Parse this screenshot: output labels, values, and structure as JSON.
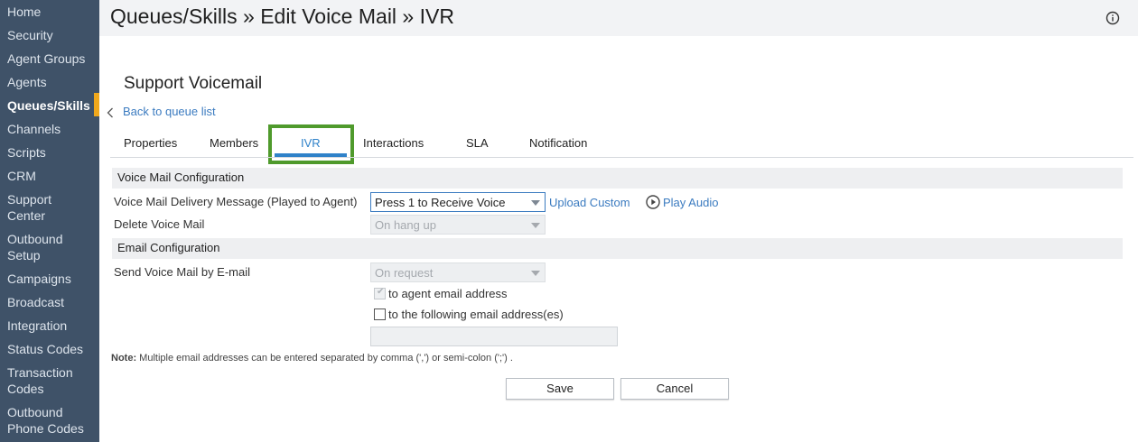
{
  "sidebar": {
    "items": [
      {
        "label": "Home"
      },
      {
        "label": "Security"
      },
      {
        "label": "Agent Groups"
      },
      {
        "label": "Agents"
      },
      {
        "label": "Queues/Skills",
        "active": true
      },
      {
        "label": "Channels"
      },
      {
        "label": "Scripts"
      },
      {
        "label": "CRM"
      },
      {
        "label": "Support Center"
      },
      {
        "label": "Outbound Setup"
      },
      {
        "label": "Campaigns"
      },
      {
        "label": "Broadcast"
      },
      {
        "label": "Integration"
      },
      {
        "label": "Status Codes"
      },
      {
        "label": "Transaction Codes"
      },
      {
        "label": "Outbound Phone Codes"
      }
    ],
    "accent_color": "#f0a81c"
  },
  "header": {
    "breadcrumb": "Queues/Skills » Edit Voice Mail » IVR",
    "info_icon": "info-icon"
  },
  "main": {
    "queue_title": "Support Voicemail",
    "back_link": "Back to queue list",
    "tabs": [
      {
        "label": "Properties"
      },
      {
        "label": "Members"
      },
      {
        "label": "IVR",
        "active": true
      },
      {
        "label": "Interactions"
      },
      {
        "label": "SLA"
      },
      {
        "label": "Notification"
      }
    ],
    "voice_mail_section": {
      "title": "Voice Mail Configuration",
      "delivery_label": "Voice Mail Delivery Message (Played to Agent)",
      "delivery_value": "Press 1 to Receive Voice",
      "upload_link": "Upload Custom",
      "play_link": "Play Audio",
      "delete_label": "Delete Voice Mail",
      "delete_value": "On hang up"
    },
    "email_section": {
      "title": "Email Configuration",
      "send_label": "Send Voice Mail by E-mail",
      "send_value": "On request",
      "agent_email_label": "to agent email address",
      "agent_email_checked": true,
      "following_email_label": "to the following email address(es)",
      "following_email_checked": false,
      "email_value": ""
    },
    "note_prefix": "Note:",
    "note_text": " Multiple email addresses can be entered separated by comma (',') or semi-colon (';') .",
    "buttons": {
      "save": "Save",
      "cancel": "Cancel"
    }
  },
  "colors": {
    "sidebar_bg": "#3f5268",
    "link": "#3b7bc0",
    "tab_active": "#2f82c9",
    "tab_highlight_box": "#4f9a2c"
  }
}
